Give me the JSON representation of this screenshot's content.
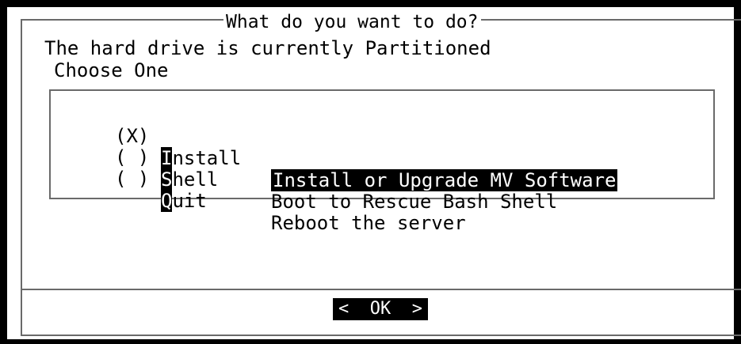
{
  "dialog": {
    "title": "What do you want to do?",
    "message_line1": "The hard drive is currently Partitioned",
    "message_line2": "Choose One"
  },
  "menu": {
    "items": [
      {
        "radio": "(X)",
        "hotkey": "I",
        "tag_rest": "nstall",
        "description": "Install or Upgrade MV Software",
        "selected": true
      },
      {
        "radio": "( )",
        "hotkey": "S",
        "tag_rest": "hell",
        "description": "Boot to Rescue Bash Shell",
        "selected": false
      },
      {
        "radio": "( )",
        "hotkey": "Q",
        "tag_rest": "uit",
        "description": "Reboot the server",
        "selected": false
      }
    ]
  },
  "buttons": {
    "ok": "<  OK  >"
  }
}
